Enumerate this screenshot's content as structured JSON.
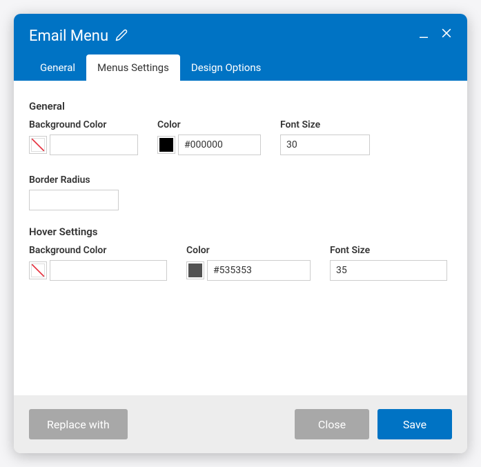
{
  "dialog": {
    "title": "Email Menu"
  },
  "tabs": {
    "general": "General",
    "menus_settings": "Menus Settings",
    "design_options": "Design Options"
  },
  "sections": {
    "general": {
      "heading": "General",
      "background_color": {
        "label": "Background Color",
        "value": ""
      },
      "color": {
        "label": "Color",
        "value": "#000000",
        "swatch": "#000000"
      },
      "font_size": {
        "label": "Font Size",
        "value": "30"
      },
      "border_radius": {
        "label": "Border Radius",
        "value": ""
      }
    },
    "hover": {
      "heading": "Hover Settings",
      "background_color": {
        "label": "Background Color",
        "value": ""
      },
      "color": {
        "label": "Color",
        "value": "#535353",
        "swatch": "#535353"
      },
      "font_size": {
        "label": "Font Size",
        "value": "35"
      }
    }
  },
  "footer": {
    "replace_with": "Replace with",
    "close": "Close",
    "save": "Save"
  }
}
